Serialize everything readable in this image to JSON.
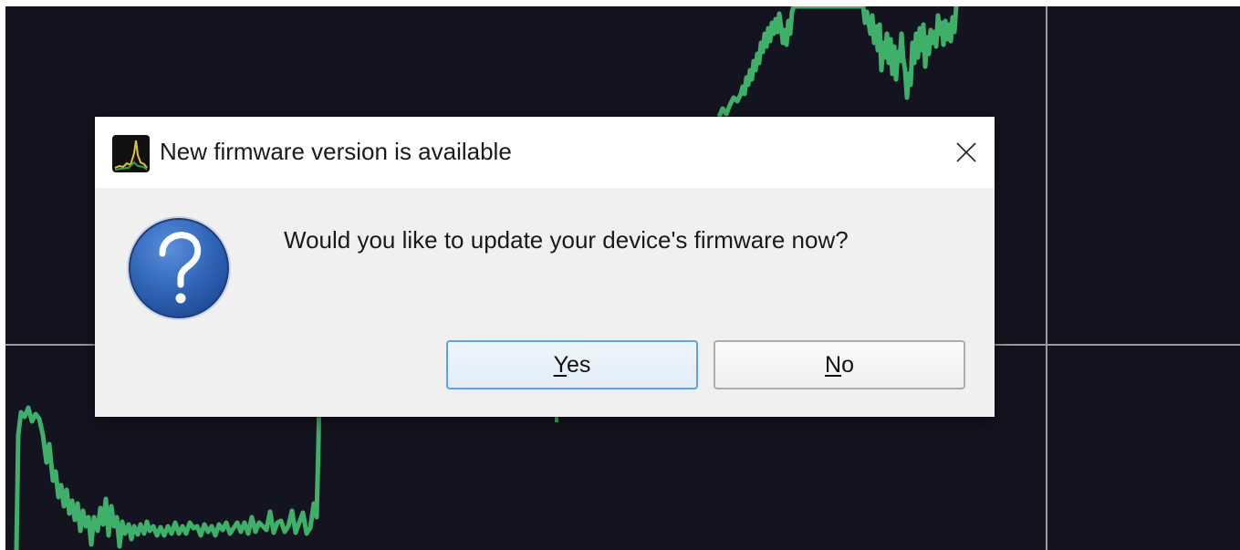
{
  "dialog": {
    "title": "New firmware version is available",
    "message": "Would you like to update your device's firmware now?",
    "buttons": {
      "yes": {
        "accel": "Y",
        "rest": "es"
      },
      "no": {
        "accel": "N",
        "rest": "o"
      }
    }
  },
  "icons": {
    "app": "spectrum-analyzer-app-icon",
    "question": "question-mark-icon",
    "close": "close-icon"
  },
  "colors": {
    "plot_background": "#13141f",
    "trace": "#3fb06a",
    "grid": "#9a9a9a",
    "dialog_background": "#f0f0f0",
    "titlebar_background": "#ffffff",
    "question_icon_blue": "#2f63b6",
    "default_button_border": "#5aa3e8"
  }
}
